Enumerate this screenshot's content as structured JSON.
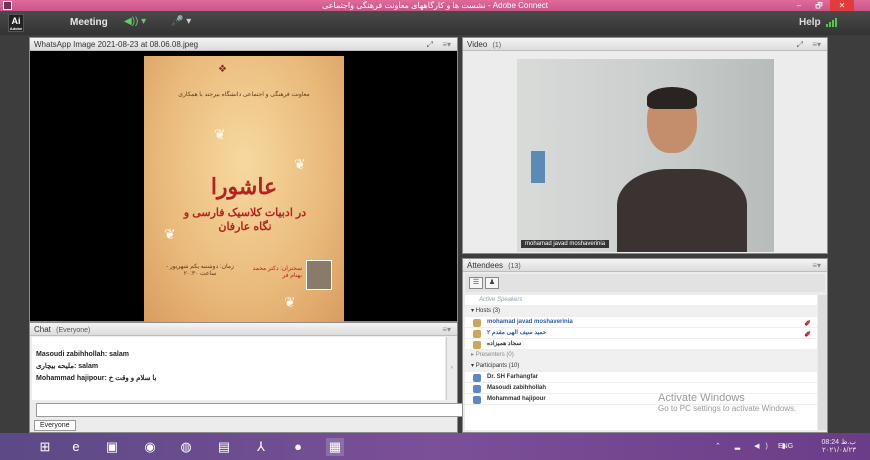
{
  "window": {
    "title": "نشست ها و کارگاههای معاونت فرهنگی واجتماعی - Adobe Connect",
    "app_icon": "adobe-connect-icon",
    "minimize": "–",
    "maximize": "🗗",
    "close": "✕"
  },
  "menubar": {
    "logo": "Ai",
    "logo_sub": "Adobe",
    "meeting_label": "Meeting",
    "speaker_control": "◀)) ▾",
    "mic_control": "🎤 ▾",
    "help_label": "Help"
  },
  "share_pod": {
    "title": "WhatsApp Image 2021-08-23 at 08.06.08.jpeg",
    "fullscreen_icon": "⤢",
    "menu_icon": "≡▾",
    "poster": {
      "header_text": "معاونت فرهنگی و اجتماعی دانشگاه بیرجند با همکاری",
      "main_title": "عاشورا",
      "sub_title": "در ادبیات کلاسیک فارسی و نگاه عارفان",
      "speaker_label": "سخنران: دکتر محمد بهنام فر",
      "time_label": "زمان: دوشنبه یکم شهریور - ساعت ۲۰:۳۰"
    }
  },
  "chat_pod": {
    "title": "Chat",
    "scope": "(Everyone)",
    "menu_icon": "≡▾",
    "messages": [
      {
        "text": "Masoudi zabihhollah: salam"
      },
      {
        "text": "ملیحه بیچاری: salam"
      },
      {
        "text": "Mohammad hajipour: با سلام و وقت خ"
      }
    ],
    "input_placeholder": "",
    "send_icon": "💬",
    "tab_label": "Everyone"
  },
  "video_pod": {
    "title": "Video",
    "count": "(1)",
    "fullscreen_icon": "⤢",
    "menu_icon": "≡▾",
    "name_tag": "mohamad javad moshaverinia"
  },
  "attendees_pod": {
    "title": "Attendees",
    "count": "(13)",
    "menu_icon": "≡▾",
    "active_speakers": "Active Speakers",
    "hosts_header": "Hosts (3)",
    "hosts": [
      {
        "name": "mohamad javad moshaverinia",
        "flag": "✐"
      },
      {
        "name": "حمید سیف الهی مقدم ۲",
        "flag": "✐"
      },
      {
        "name": "سجاد همیزاده",
        "flag": ""
      }
    ],
    "presenters_header": "Presenters (0)",
    "participants_header": "Participants (10)",
    "participants": [
      {
        "name": "Dr. SH Farhangfar"
      },
      {
        "name": "Masoudi zabihhollah"
      },
      {
        "name": "Mohammad hajipour"
      }
    ]
  },
  "watermark": {
    "line1": "Activate Windows",
    "line2": "Go to PC settings to activate Windows."
  },
  "taskbar": {
    "start_icon": "⊞",
    "apps": [
      {
        "name": "ie-icon",
        "glyph": "e"
      },
      {
        "name": "store-icon",
        "glyph": "▣"
      },
      {
        "name": "firefox-icon",
        "glyph": "◉"
      },
      {
        "name": "chrome-icon",
        "glyph": "◍"
      },
      {
        "name": "folder-icon",
        "glyph": "▤"
      },
      {
        "name": "acrobat-icon",
        "glyph": "⅄"
      },
      {
        "name": "fox-icon",
        "glyph": "●"
      },
      {
        "name": "adobe-connect-icon",
        "glyph": "▦"
      }
    ],
    "tray": "⌃ ▂ ◀) ▮",
    "language": "ENG",
    "time": "08:24 ب.ظ",
    "date": "۲۰۲۱/۰۸/۲۳"
  }
}
